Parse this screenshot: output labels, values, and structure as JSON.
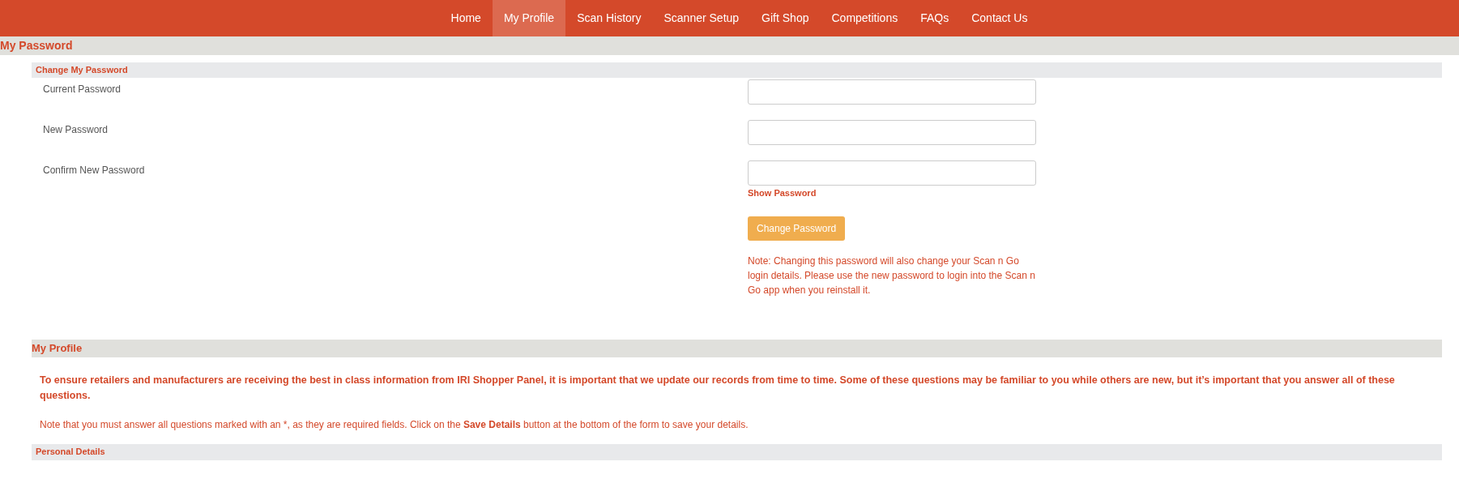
{
  "nav": [
    {
      "label": "Home",
      "selected": false
    },
    {
      "label": "My Profile",
      "selected": true
    },
    {
      "label": "Scan History",
      "selected": false
    },
    {
      "label": "Scanner Setup",
      "selected": false
    },
    {
      "label": "Gift Shop",
      "selected": false
    },
    {
      "label": "Competitions",
      "selected": false
    },
    {
      "label": "FAQs",
      "selected": false
    },
    {
      "label": "Contact Us",
      "selected": false
    }
  ],
  "page_title": "My Password",
  "change_password": {
    "heading": "Change My Password",
    "fields": [
      {
        "label": "Current Password"
      },
      {
        "label": "New Password"
      },
      {
        "label": "Confirm New Password"
      }
    ],
    "show_password": "Show Password",
    "button": "Change Password",
    "note": "Note: Changing this password will also change your Scan n Go login details. Please use the new password to login into the Scan n Go app when you reinstall it."
  },
  "profile": {
    "heading": "My Profile",
    "intro": "To ensure retailers and manufacturers are receiving the best in class information from IRI Shopper Panel, it is important that we update our records from time to time. Some of these questions may be familiar to you while others are new, but it’s important that you answer all of these questions.",
    "note": "Note that you must answer all questions marked with an *, as they are required fields. Click on the **Save Details** button at the bottom of the form to save your details.",
    "subheading": "Personal Details"
  }
}
